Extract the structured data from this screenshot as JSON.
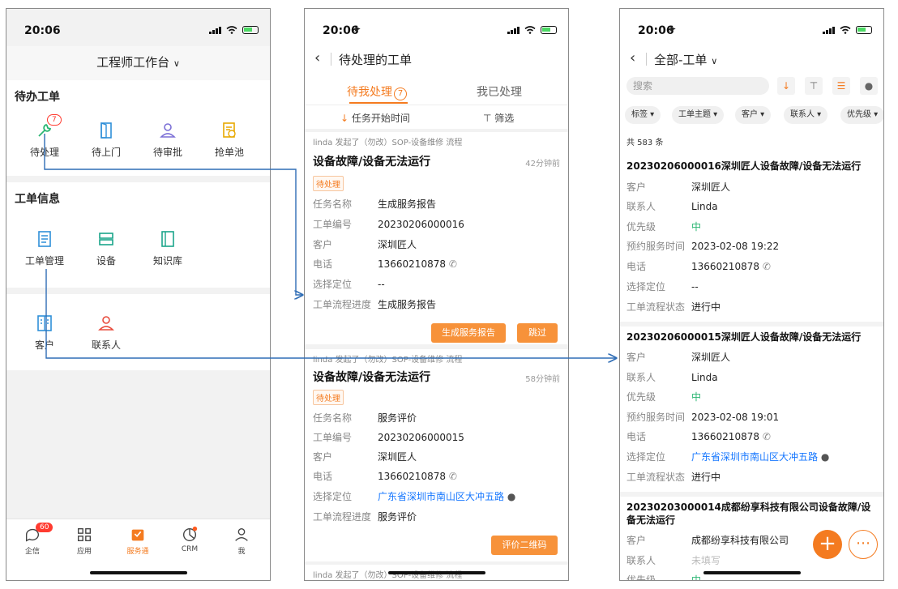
{
  "p1": {
    "time": "20:06",
    "title": "工程师工作台",
    "todo_heading": "待办工单",
    "todo_items": [
      {
        "label": "待处理",
        "badge": "7"
      },
      {
        "label": "待上门"
      },
      {
        "label": "待审批"
      },
      {
        "label": "抢单池"
      }
    ],
    "info_heading": "工单信息",
    "info_items": [
      {
        "label": "工单管理"
      },
      {
        "label": "设备"
      },
      {
        "label": "知识库"
      }
    ],
    "contact_items": [
      {
        "label": "客户"
      },
      {
        "label": "联系人"
      }
    ],
    "tabs": [
      {
        "label": "企信",
        "badge": "60"
      },
      {
        "label": "应用"
      },
      {
        "label": "服务通"
      },
      {
        "label": "CRM"
      },
      {
        "label": "我"
      }
    ],
    "accent": "#f47b20"
  },
  "p2": {
    "time": "20:06",
    "nav_title": "待处理的工单",
    "tab_active": "待我处理",
    "tab_active_count": "7",
    "tab_other": "我已处理",
    "sort_label": "任务开始时间",
    "filter_label": "筛选",
    "cards": [
      {
        "initiator": "linda 发起了（勿改）SOP-设备维修 流程",
        "title": "设备故障/设备无法运行",
        "time": "42分钟前",
        "tag": "待处理",
        "fields": [
          {
            "k": "任务名称",
            "v": "生成服务报告"
          },
          {
            "k": "工单编号",
            "v": "20230206000016"
          },
          {
            "k": "客户",
            "v": "深圳匠人"
          },
          {
            "k": "电话",
            "v": "13660210878"
          },
          {
            "k": "选择定位",
            "v": "--"
          },
          {
            "k": "工单流程进度",
            "v": "生成服务报告"
          }
        ],
        "btn1": "生成服务报告",
        "btn2": "跳过"
      },
      {
        "initiator": "linda 发起了（勿改）SOP-设备维修 流程",
        "title": "设备故障/设备无法运行",
        "time": "58分钟前",
        "tag": "待处理",
        "fields": [
          {
            "k": "任务名称",
            "v": "服务评价"
          },
          {
            "k": "工单编号",
            "v": "20230206000015"
          },
          {
            "k": "客户",
            "v": "深圳匠人"
          },
          {
            "k": "电话",
            "v": "13660210878"
          },
          {
            "k": "选择定位",
            "v": "广东省深圳市南山区大冲五路"
          },
          {
            "k": "工单流程进度",
            "v": "服务评价"
          }
        ],
        "btn1": "评价二维码"
      },
      {
        "initiator": "linda 发起了（勿改）SOP-设备维修 流程"
      }
    ]
  },
  "p3": {
    "time": "20:06",
    "nav_title": "全部-工单",
    "search_placeholder": "搜索",
    "chips": [
      "标签",
      "工单主题",
      "客户",
      "联系人",
      "优先级"
    ],
    "total": "共 583 条",
    "records": [
      {
        "title": "20230206000016深圳匠人设备故障/设备无法运行",
        "fields": [
          {
            "k": "客户",
            "v": "深圳匠人"
          },
          {
            "k": "联系人",
            "v": "Linda"
          },
          {
            "k": "优先级",
            "v": "中"
          },
          {
            "k": "预约服务时间",
            "v": "2023-02-08 19:22"
          },
          {
            "k": "电话",
            "v": "13660210878"
          },
          {
            "k": "选择定位",
            "v": "--"
          },
          {
            "k": "工单流程状态",
            "v": "进行中"
          }
        ]
      },
      {
        "title": "20230206000015深圳匠人设备故障/设备无法运行",
        "fields": [
          {
            "k": "客户",
            "v": "深圳匠人"
          },
          {
            "k": "联系人",
            "v": "Linda"
          },
          {
            "k": "优先级",
            "v": "中"
          },
          {
            "k": "预约服务时间",
            "v": "2023-02-08 19:01"
          },
          {
            "k": "电话",
            "v": "13660210878"
          },
          {
            "k": "选择定位",
            "v": "广东省深圳市南山区大冲五路"
          },
          {
            "k": "工单流程状态",
            "v": "进行中"
          }
        ]
      },
      {
        "title": "20230203000014成都纷享科技有限公司设备故障/设备无法运行",
        "fields": [
          {
            "k": "客户",
            "v": "成都纷享科技有限公司"
          },
          {
            "k": "联系人",
            "v": "未填写"
          },
          {
            "k": "优先级",
            "v": "中"
          }
        ]
      }
    ],
    "fab_plus": "+",
    "fab_more": "⋯"
  },
  "colors": {
    "accent": "#f47b20",
    "link": "#1677ff",
    "priority": "#2bb673",
    "connector": "#2f6db5"
  }
}
